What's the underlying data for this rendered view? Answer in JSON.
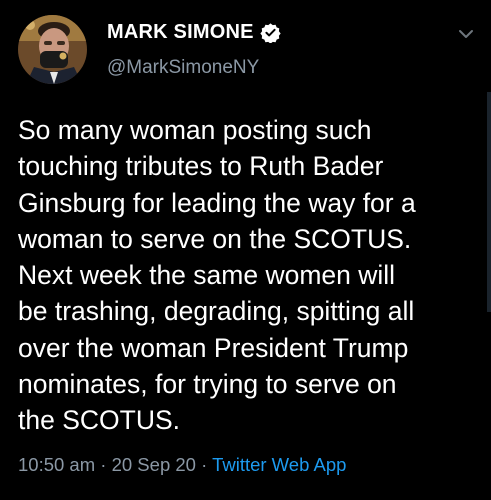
{
  "user": {
    "display_name": "MARK SIMONE",
    "handle": "@MarkSimoneNY",
    "verified_icon": "verified-badge-icon",
    "verified_color": "#1d9bf0"
  },
  "tweet": {
    "text": "So many woman posting such\ntouching tributes to Ruth Bader\nGinsburg for leading the way for a\nwoman to serve on the SCOTUS.\nNext week the same women will\nbe trashing, degrading, spitting all\nover the woman President Trump\nnominates, for trying to serve on\nthe SCOTUS."
  },
  "meta": {
    "time": "10:50 am",
    "separator": " · ",
    "date": "20 Sep 20",
    "source": "Twitter Web App"
  },
  "colors": {
    "background": "#000000",
    "primary_text": "#ffffff",
    "secondary_text": "#8b98a5",
    "link": "#1d9bf0"
  },
  "icons": {
    "more_menu": "chevron-down-icon"
  }
}
